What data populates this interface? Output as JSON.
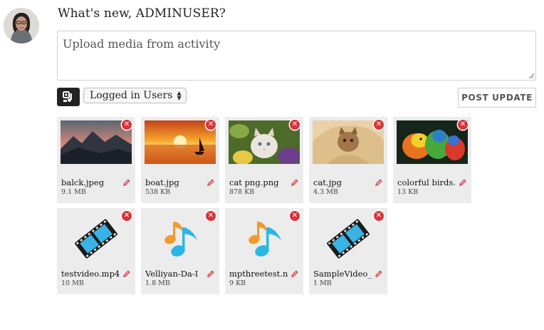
{
  "composer": {
    "title": "What's new, ADMINUSER?",
    "textarea_value": "Upload media from activity",
    "privacy_selected": "Logged in Users",
    "post_label": "POST UPDATE"
  },
  "media": [
    {
      "name": "balck.jpeg",
      "size": "9.1 MB",
      "kind": "image",
      "scene": "mountains"
    },
    {
      "name": "boat.jpg",
      "size": "538 KB",
      "kind": "image",
      "scene": "sunset-boat"
    },
    {
      "name": "cat png.png",
      "size": "878 KB",
      "kind": "image",
      "scene": "kitten-flowers"
    },
    {
      "name": "cat.jpg",
      "size": "4.3 MB",
      "kind": "image",
      "scene": "cat-blanket"
    },
    {
      "name": "colorful birds.",
      "size": "13 KB",
      "kind": "image",
      "scene": "parrots"
    },
    {
      "name": "testvideo.mp4",
      "size": "10 MB",
      "kind": "video"
    },
    {
      "name": "Velliyan-Da-I",
      "size": "1.8 MB",
      "kind": "audio"
    },
    {
      "name": "mpthreetest.n",
      "size": "9 KB",
      "kind": "audio"
    },
    {
      "name": "SampleVideo_",
      "size": "1 MB",
      "kind": "video"
    }
  ],
  "colors": {
    "remove": "#d9343b",
    "edit": "#d9343b",
    "card_bg": "#ececec",
    "audio_orange": "#f39a2a",
    "audio_blue": "#2bb7e4",
    "video_blue": "#39b3e6"
  },
  "icons": {
    "remove": "close-circle-icon",
    "edit": "pencil-icon",
    "upload": "media-upload-icon",
    "video": "film-strip-icon",
    "audio": "music-note-icon"
  }
}
